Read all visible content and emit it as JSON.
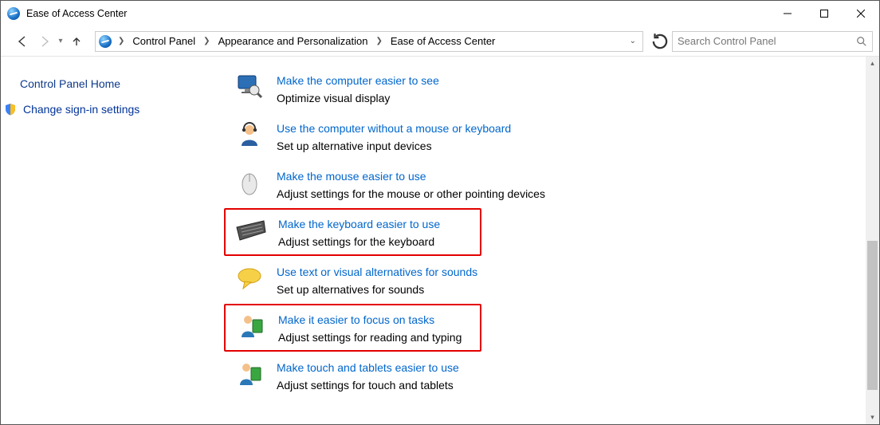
{
  "window": {
    "title": "Ease of Access Center"
  },
  "breadcrumb": {
    "items": [
      "Control Panel",
      "Appearance and Personalization",
      "Ease of Access Center"
    ]
  },
  "search": {
    "placeholder": "Search Control Panel"
  },
  "sidebar": {
    "items": [
      {
        "label": "Control Panel Home",
        "shield": false
      },
      {
        "label": "Change sign-in settings",
        "shield": true
      }
    ]
  },
  "options": [
    {
      "icon": "monitor-magnifier-icon",
      "title": "Make the computer easier to see",
      "desc": "Optimize visual display",
      "highlight": false
    },
    {
      "icon": "headset-person-icon",
      "title": "Use the computer without a mouse or keyboard",
      "desc": "Set up alternative input devices",
      "highlight": false
    },
    {
      "icon": "mouse-icon",
      "title": "Make the mouse easier to use",
      "desc": "Adjust settings for the mouse or other pointing devices",
      "highlight": false
    },
    {
      "icon": "keyboard-icon",
      "title": "Make the keyboard easier to use",
      "desc": "Adjust settings for the keyboard",
      "highlight": true
    },
    {
      "icon": "speech-bubble-icon",
      "title": "Use text or visual alternatives for sounds",
      "desc": "Set up alternatives for sounds",
      "highlight": false
    },
    {
      "icon": "person-book-icon",
      "title": "Make it easier to focus on tasks",
      "desc": "Adjust settings for reading and typing",
      "highlight": true
    },
    {
      "icon": "person-book-icon",
      "title": "Make touch and tablets easier to use",
      "desc": "Adjust settings for touch and tablets",
      "highlight": false
    }
  ]
}
